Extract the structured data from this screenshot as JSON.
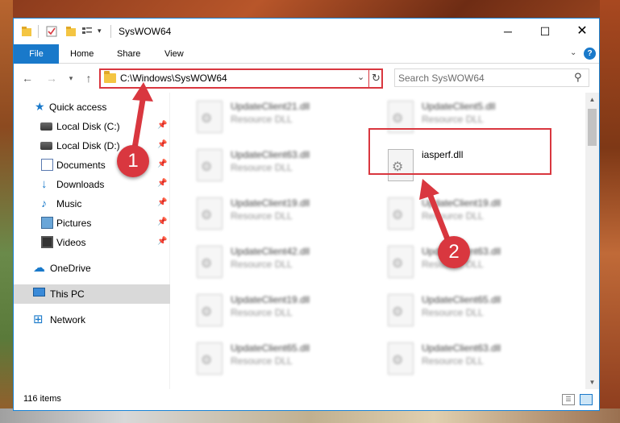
{
  "window": {
    "title": "SysWOW64",
    "controls": {
      "minimize": "─",
      "maximize": "☐",
      "close": "✕"
    }
  },
  "ribbon": {
    "tabs": [
      "File",
      "Home",
      "Share",
      "View"
    ],
    "help": "?"
  },
  "navigation": {
    "address_path": "C:\\Windows\\SysWOW64",
    "search_placeholder": "Search SysWOW64"
  },
  "sidebar": {
    "items": [
      {
        "label": "Quick access",
        "icon": "star-icon",
        "pinned": false
      },
      {
        "label": "Local Disk (C:)",
        "icon": "drive-icon",
        "pinned": true
      },
      {
        "label": "Local Disk (D:)",
        "icon": "drive-icon",
        "pinned": true
      },
      {
        "label": "Documents",
        "icon": "documents-icon",
        "pinned": true
      },
      {
        "label": "Downloads",
        "icon": "download-icon",
        "pinned": true
      },
      {
        "label": "Music",
        "icon": "music-icon",
        "pinned": true
      },
      {
        "label": "Pictures",
        "icon": "pictures-icon",
        "pinned": true
      },
      {
        "label": "Videos",
        "icon": "videos-icon",
        "pinned": true
      },
      {
        "label": "OneDrive",
        "icon": "cloud-icon",
        "pinned": false
      },
      {
        "label": "This PC",
        "icon": "computer-icon",
        "pinned": false,
        "selected": true
      },
      {
        "label": "Network",
        "icon": "network-icon",
        "pinned": false
      }
    ]
  },
  "files": {
    "left_column": [
      {
        "name": "UpdateClient21.dll",
        "type": "Resource DLL"
      },
      {
        "name": "UpdateClient63.dll",
        "type": "Resource DLL"
      },
      {
        "name": "UpdateClient19.dll",
        "type": "Resource DLL"
      },
      {
        "name": "UpdateClient42.dll",
        "type": "Resource DLL"
      },
      {
        "name": "UpdateClient19.dll",
        "type": "Resource DLL"
      },
      {
        "name": "UpdateClient65.dll",
        "type": "Resource DLL"
      }
    ],
    "right_column": [
      {
        "name": "UpdateClient5.dll",
        "type": "Resource DLL"
      },
      {
        "name": "iasperf.dll",
        "type": "",
        "highlighted": true
      },
      {
        "name": "UpdateClient19.dll",
        "type": "Resource DLL"
      },
      {
        "name": "UpdateClient63.dll",
        "type": "Resource DLL"
      },
      {
        "name": "UpdateClient65.dll",
        "type": "Resource DLL"
      },
      {
        "name": "UpdateClient63.dll",
        "type": "Resource DLL"
      }
    ]
  },
  "status": {
    "item_count": "116 items"
  },
  "callouts": {
    "step1": "1",
    "step2": "2"
  },
  "colors": {
    "accent": "#1979ca",
    "highlight": "#d9373f"
  }
}
